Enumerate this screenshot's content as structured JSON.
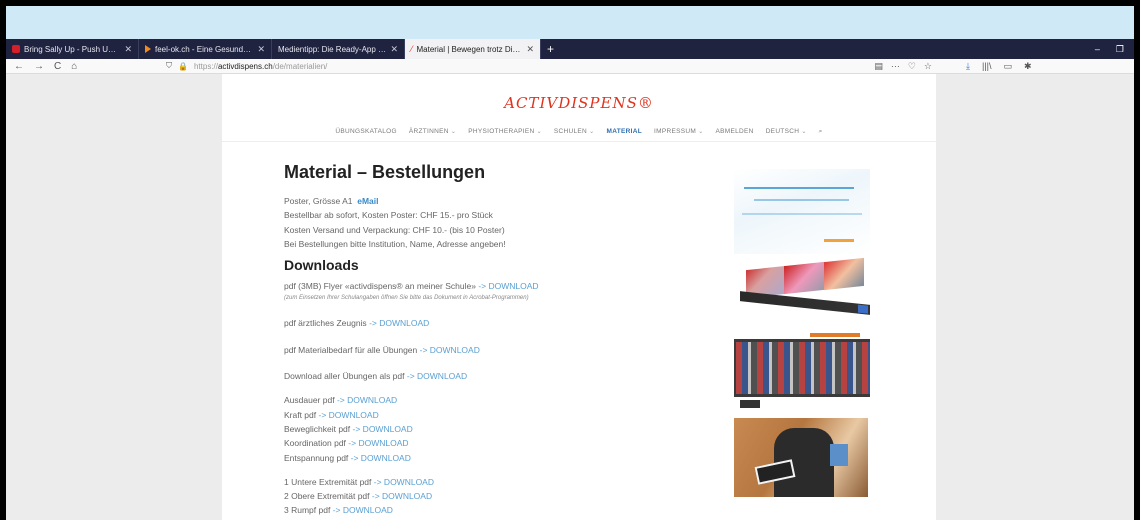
{
  "browser": {
    "tabs": [
      {
        "title": "Bring Sally Up - Push Up Chall",
        "favicon": "youtube-icon",
        "active": false
      },
      {
        "title": "feel-ok.ch - Eine Gesundheitsp",
        "favicon": "feelok-icon",
        "active": false
      },
      {
        "title": "Medientipp: Die Ready-App unter",
        "favicon": "page-icon",
        "active": false
      },
      {
        "title": "Material | Bewegen trotz Dispe",
        "favicon": "activdispens-icon",
        "active": true
      }
    ],
    "new_tab": "+",
    "close_glyph": "✕",
    "window_controls": {
      "minimize": "–",
      "restore": "❐"
    },
    "nav": {
      "back": "←",
      "forward": "→",
      "reload": "C",
      "home": "⌂"
    },
    "url": {
      "prefix": "https://",
      "domain": "activdispens.ch",
      "path": "/de/materialien/"
    },
    "url_icons": {
      "reader": "▤",
      "menu": "···",
      "pocket": "♡",
      "bookmark": "☆"
    },
    "tool_icons": {
      "download": "⤓",
      "library": "|||\\",
      "sidebar": "▭",
      "extension": "✱"
    }
  },
  "site": {
    "logo": "ACTIVDISPENS®",
    "nav": [
      {
        "label": "ÜBUNGSKATALOG",
        "dropdown": false,
        "active": false
      },
      {
        "label": "ÄRZTINNEN",
        "dropdown": true,
        "active": false
      },
      {
        "label": "PHYSIOTHERAPIEN",
        "dropdown": true,
        "active": false
      },
      {
        "label": "SCHULEN",
        "dropdown": true,
        "active": false
      },
      {
        "label": "MATERIAL",
        "dropdown": false,
        "active": true
      },
      {
        "label": "IMPRESSUM",
        "dropdown": true,
        "active": false
      },
      {
        "label": "ABMELDEN",
        "dropdown": false,
        "active": false
      },
      {
        "label": "DEUTSCH",
        "dropdown": true,
        "active": false
      }
    ],
    "nav_chevron": "⌄",
    "search_icon": "⌕"
  },
  "content": {
    "title": "Material – Bestellungen",
    "poster_line": "Poster, Grösse A1",
    "poster_email": "eMail",
    "order_lines": [
      "Bestellbar ab sofort, Kosten Poster: CHF 15.- pro Stück",
      "Kosten Versand und Verpackung: CHF 10.- (bis 10 Poster)",
      "Bei Bestellungen bitte Institution, Name, Adresse angeben!"
    ],
    "downloads_title": "Downloads",
    "flyer_label": "pdf (3MB)  Flyer «activdispens®  an meiner Schule»",
    "flyer_note": "(zum Einsetzen Ihrer Schulangaben öffnen Sie bitte das Dokument in Acrobat-Programmen)",
    "download_link": "-> DOWNLOAD",
    "single_downloads": [
      "pdf ärztliches Zeugnis",
      "pdf Materialbedarf für alle Übungen",
      "Download aller Übungen als pdf"
    ],
    "category_downloads": [
      "Ausdauer pdf",
      "Kraft pdf",
      "Beweglichkeit pdf",
      "Koordination pdf",
      "Entspannung pdf"
    ],
    "body_downloads": [
      "1 Untere Extremität pdf",
      "2 Obere Extremität pdf",
      "3 Rumpf pdf"
    ]
  }
}
